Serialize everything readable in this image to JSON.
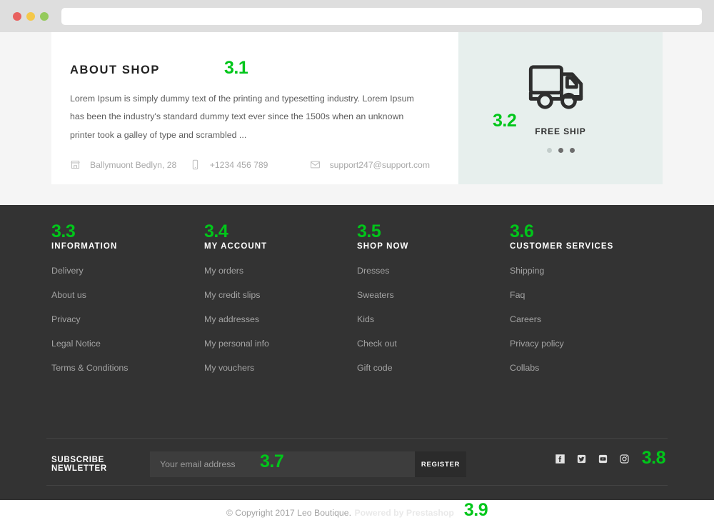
{
  "browser": {
    "address_value": "",
    "address_placeholder": "",
    "traffic_lights": [
      "close-red",
      "minimize-yellow",
      "maximize-green"
    ]
  },
  "about": {
    "title": "ABOUT SHOP",
    "marker": "3.1",
    "body": "Lorem Ipsum is simply dummy text of the printing and typesetting industry. Lorem Ipsum has been the industry's standard dummy text ever since the 1500s when an unknown printer took a galley of type and scrambled ...",
    "contacts": [
      {
        "icon": "shop-icon",
        "text": "Ballymuont Bedlyn, 28"
      },
      {
        "icon": "mobile-phone-icon",
        "text": "+1234 456 789"
      },
      {
        "icon": "envelope-icon",
        "text": "support247@support.com"
      }
    ]
  },
  "service": {
    "marker": "3.2",
    "icon": "delivery-truck-icon",
    "label": "FREE SHIP",
    "dots": [
      "inactive",
      "active",
      "active"
    ]
  },
  "footer": {
    "columns": [
      {
        "marker": "3.3",
        "title": "INFORMATION",
        "links": [
          "Delivery",
          "About us",
          "Privacy",
          "Legal Notice",
          "Terms & Conditions"
        ]
      },
      {
        "marker": "3.4",
        "title": "MY ACCOUNT",
        "links": [
          "My orders",
          "My credit slips",
          "My addresses",
          "My personal info",
          "My vouchers"
        ]
      },
      {
        "marker": "3.5",
        "title": "SHOP NOW",
        "links": [
          "Dresses",
          "Sweaters",
          "Kids",
          "Check out",
          "Gift code"
        ]
      },
      {
        "marker": "3.6",
        "title": "CUSTOMER SERVICES",
        "links": [
          "Shipping",
          "Faq",
          "Careers",
          "Privacy policy",
          "Collabs"
        ]
      }
    ],
    "newsletter": {
      "title": "SUBSCRIBE NEWLETTER",
      "input_value": "",
      "input_placeholder": "Your email address",
      "marker": "3.7",
      "button_label": "REGISTER"
    },
    "socials": {
      "marker": "3.8",
      "items": [
        "facebook-icon",
        "twitter-icon",
        "youtube-icon",
        "instagram-icon"
      ]
    },
    "copyright": {
      "text": "© Copyright 2017 Leo Boutique.",
      "strong": "Powered by Prestashop",
      "marker": "3.9"
    }
  },
  "colors": {
    "accent_marker": "#00c61a",
    "footer_bg": "#333333",
    "service_bg": "#e7efed",
    "page_bg": "#f5f5f5",
    "chrome_bg": "#dedede"
  }
}
